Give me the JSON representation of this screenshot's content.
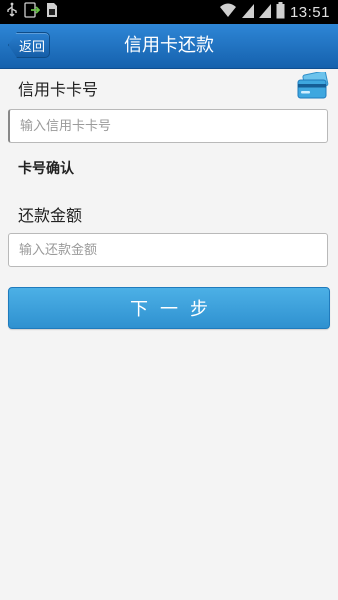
{
  "status_bar": {
    "time": "13:51",
    "icons": [
      "usb-icon",
      "transfer-icon",
      "sim-icon",
      "wifi-icon",
      "signal-icon",
      "signal-icon",
      "battery-icon"
    ]
  },
  "header": {
    "back_label": "返回",
    "title": "信用卡还款"
  },
  "form": {
    "card_number_label": "信用卡卡号",
    "card_number_placeholder": "输入信用卡卡号",
    "card_number_value": "",
    "card_icon": "credit-card-icon",
    "confirm_label": "卡号确认",
    "amount_label": "还款金额",
    "amount_placeholder": "输入还款金额",
    "amount_value": "",
    "next_button_label": "下一步"
  },
  "colors": {
    "title_bar": "#1f72c4",
    "button": "#3a9edb",
    "background": "#f4f4f4"
  }
}
